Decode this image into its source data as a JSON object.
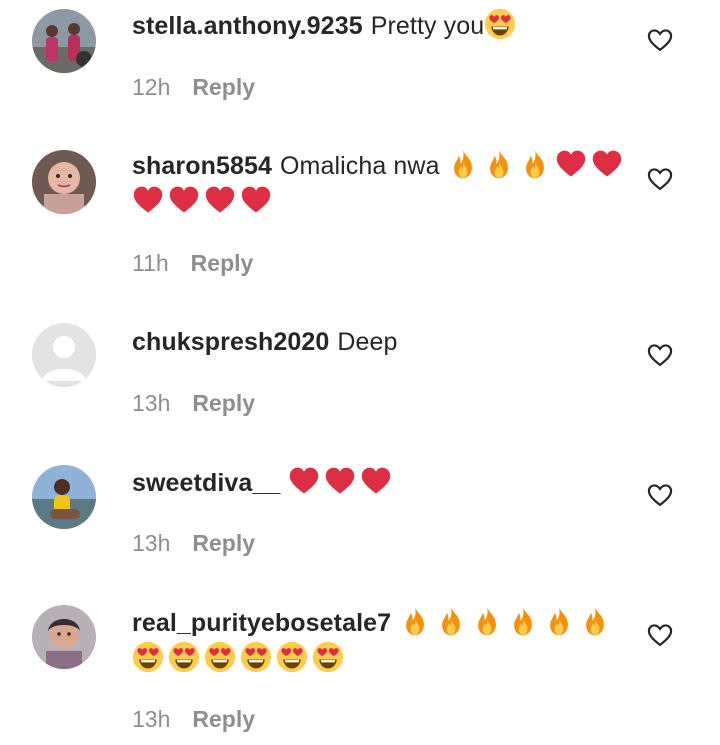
{
  "comments": [
    {
      "username": "stella.anthony.9235",
      "text": "Pretty you",
      "emojis": [
        "heart-eyes"
      ],
      "time": "12h",
      "reply_label": "Reply",
      "avatar": "photo-avatar"
    },
    {
      "username": "sharon5854",
      "text": "Omalicha nwa",
      "emojis": [
        "fire",
        "fire",
        "fire",
        "red-heart",
        "red-heart",
        "red-heart",
        "red-heart",
        "red-heart",
        "red-heart"
      ],
      "time": "11h",
      "reply_label": "Reply",
      "avatar": "photo-avatar"
    },
    {
      "username": "chukspresh2020",
      "text": "Deep",
      "emojis": [],
      "time": "13h",
      "reply_label": "Reply",
      "avatar": "default-avatar"
    },
    {
      "username": "sweetdiva__",
      "text": "",
      "emojis": [
        "red-heart",
        "red-heart",
        "red-heart"
      ],
      "time": "13h",
      "reply_label": "Reply",
      "avatar": "photo-avatar"
    },
    {
      "username": "real_purityebosetale7",
      "text": "",
      "emojis": [
        "fire",
        "fire",
        "fire",
        "fire",
        "fire",
        "fire",
        "heart-eyes",
        "heart-eyes",
        "heart-eyes",
        "heart-eyes",
        "heart-eyes",
        "heart-eyes"
      ],
      "time": "13h",
      "reply_label": "Reply",
      "avatar": "photo-avatar"
    }
  ],
  "colors": {
    "text": "#262626",
    "secondary": "#8e8e8e",
    "heart_red": "#dd2e44",
    "fire_orange": "#f4900c"
  }
}
